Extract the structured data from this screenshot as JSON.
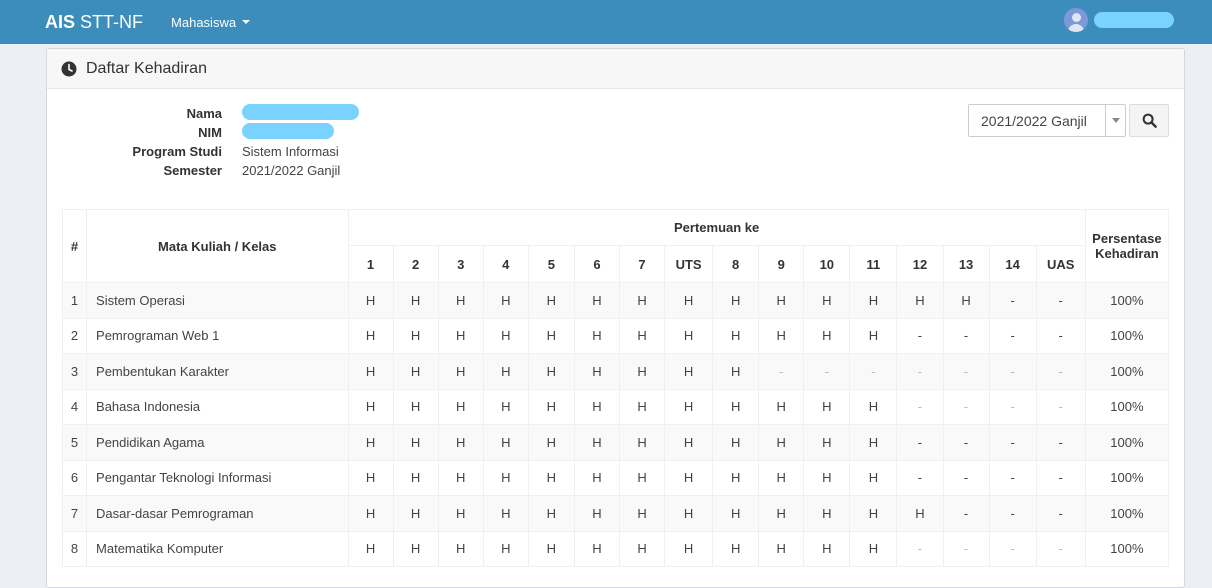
{
  "navbar": {
    "brand_bold": "AIS",
    "brand_rest": "STT-NF",
    "menu_label": "Mahasiswa",
    "user_name": "User"
  },
  "panel": {
    "title": "Daftar Kehadiran"
  },
  "info": {
    "nama_label": "Nama",
    "nim_label": "NIM",
    "prodi_label": "Program Studi",
    "prodi_value": "Sistem Informasi",
    "semester_label": "Semester",
    "semester_value": "2021/2022 Ganjil"
  },
  "filter": {
    "semester_selected": "2021/2022 Ganjil"
  },
  "table": {
    "col_no": "#",
    "col_course": "Mata Kuliah / Kelas",
    "col_meetings": "Pertemuan ke",
    "col_percent": "Persentase Kehadiran",
    "meetings": [
      "1",
      "2",
      "3",
      "4",
      "5",
      "6",
      "7",
      "UTS",
      "8",
      "9",
      "10",
      "11",
      "12",
      "13",
      "14",
      "UAS"
    ],
    "rows": [
      {
        "no": "1",
        "course": "Sistem Operasi",
        "marks": [
          "H",
          "H",
          "H",
          "H",
          "H",
          "H",
          "H",
          "H",
          "H",
          "H",
          "H",
          "H",
          "H",
          "H",
          "-",
          "-"
        ],
        "percent": "100%"
      },
      {
        "no": "2",
        "course": "Pemrograman Web 1",
        "marks": [
          "H",
          "H",
          "H",
          "H",
          "H",
          "H",
          "H",
          "H",
          "H",
          "H",
          "H",
          "H",
          "-",
          "-",
          "-",
          "-"
        ],
        "percent": "100%"
      },
      {
        "no": "3",
        "course": "Pembentukan Karakter",
        "marks": [
          "H",
          "H",
          "H",
          "H",
          "H",
          "H",
          "H",
          "H",
          "H",
          "-",
          "-",
          "-",
          "-",
          "-",
          "-",
          "-"
        ],
        "percent": "100%"
      },
      {
        "no": "4",
        "course": "Bahasa Indonesia",
        "marks": [
          "H",
          "H",
          "H",
          "H",
          "H",
          "H",
          "H",
          "H",
          "H",
          "H",
          "H",
          "H",
          "-",
          "-",
          "-",
          "-"
        ],
        "percent": "100%"
      },
      {
        "no": "5",
        "course": "Pendidikan Agama",
        "marks": [
          "H",
          "H",
          "H",
          "H",
          "H",
          "H",
          "H",
          "H",
          "H",
          "H",
          "H",
          "H",
          "-",
          "-",
          "-",
          "-"
        ],
        "percent": "100%"
      },
      {
        "no": "6",
        "course": "Pengantar Teknologi Informasi",
        "marks": [
          "H",
          "H",
          "H",
          "H",
          "H",
          "H",
          "H",
          "H",
          "H",
          "H",
          "H",
          "H",
          "-",
          "-",
          "-",
          "-"
        ],
        "percent": "100%"
      },
      {
        "no": "7",
        "course": "Dasar-dasar Pemrograman",
        "marks": [
          "H",
          "H",
          "H",
          "H",
          "H",
          "H",
          "H",
          "H",
          "H",
          "H",
          "H",
          "H",
          "H",
          "-",
          "-",
          "-"
        ],
        "percent": "100%"
      },
      {
        "no": "8",
        "course": "Matematika Komputer",
        "marks": [
          "H",
          "H",
          "H",
          "H",
          "H",
          "H",
          "H",
          "H",
          "H",
          "H",
          "H",
          "H",
          "-",
          "-",
          "-",
          "-"
        ],
        "percent": "100%"
      }
    ]
  },
  "colors": {
    "navbar": "#3c8dbc",
    "background": "#ecf0f5",
    "redaction": "#7ad2ff"
  }
}
